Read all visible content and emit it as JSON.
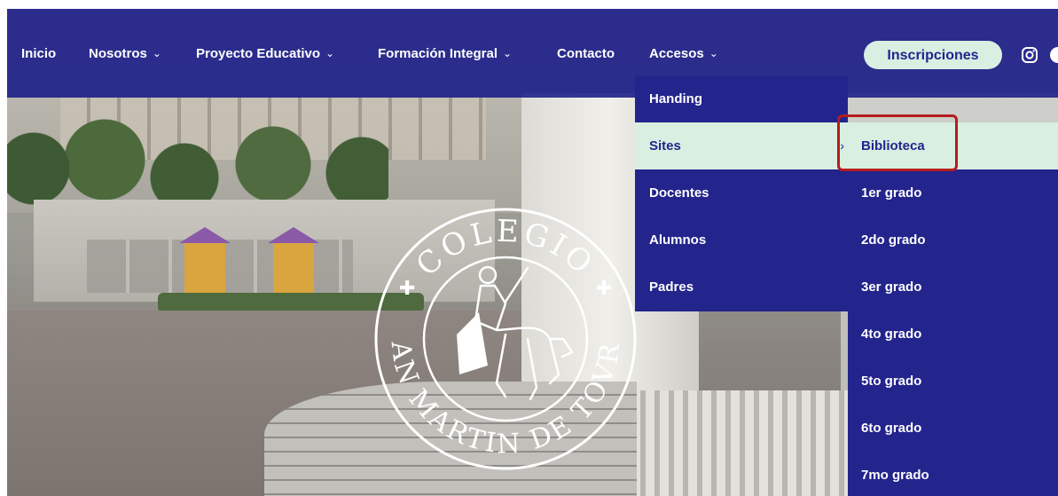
{
  "nav": {
    "items": [
      {
        "label": "Inicio",
        "has_dropdown": false
      },
      {
        "label": "Nosotros",
        "has_dropdown": true
      },
      {
        "label": "Proyecto Educativo",
        "has_dropdown": true
      },
      {
        "label": "Formación Integral",
        "has_dropdown": true
      },
      {
        "label": "Contacto",
        "has_dropdown": false
      },
      {
        "label": "Accesos",
        "has_dropdown": true
      }
    ],
    "chevron": "⌄",
    "cta_label": "Inscripciones",
    "icons": [
      "instagram-icon",
      "facebook-icon"
    ]
  },
  "accesos_menu": {
    "items": [
      {
        "label": "Handing",
        "active": false
      },
      {
        "label": "Sites",
        "active": true
      },
      {
        "label": "Docentes",
        "active": false
      },
      {
        "label": "Alumnos",
        "active": false
      },
      {
        "label": "Padres",
        "active": false
      }
    ],
    "submenu_arrow": "›"
  },
  "sites_submenu": {
    "items": [
      {
        "label": "Biblioteca",
        "active": true
      },
      {
        "label": "1er grado",
        "active": false
      },
      {
        "label": "2do grado",
        "active": false
      },
      {
        "label": "3er grado",
        "active": false
      },
      {
        "label": "4to grado",
        "active": false
      },
      {
        "label": "5to grado",
        "active": false
      },
      {
        "label": "6to grado",
        "active": false
      },
      {
        "label": "7mo grado",
        "active": false
      }
    ]
  },
  "crest": {
    "top_text": "COLEGIO",
    "bottom_text": "SAN MARTIN DE TOVRS"
  },
  "colors": {
    "nav_bg": "#23248c",
    "active_bg": "#d8efe1",
    "highlight": "#b41c1c"
  }
}
